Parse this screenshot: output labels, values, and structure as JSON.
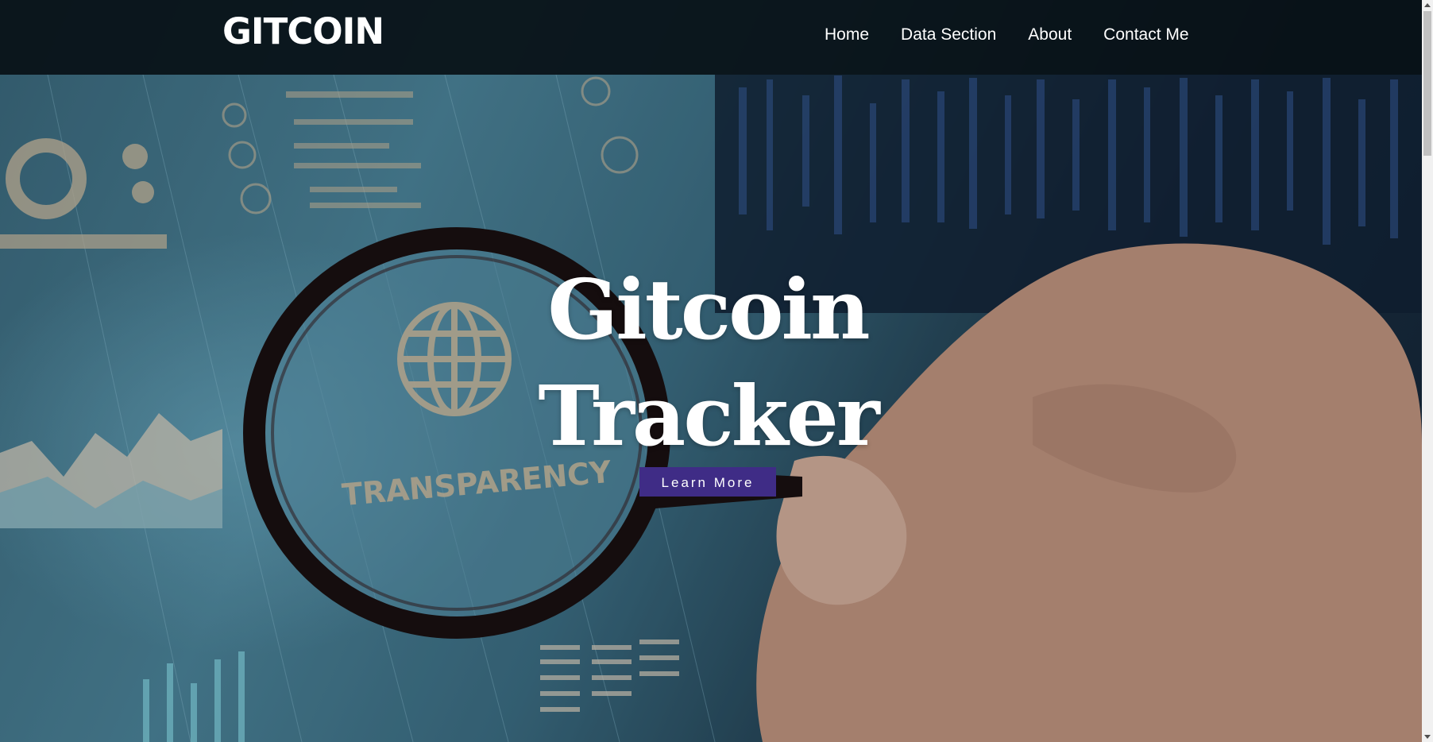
{
  "nav": {
    "logo": "GITCOIN",
    "links": [
      {
        "label": "Home"
      },
      {
        "label": "Data Section"
      },
      {
        "label": "About"
      },
      {
        "label": "Contact Me"
      }
    ]
  },
  "hero": {
    "title_line1": "Gitcoin",
    "title_line2": "Tracker",
    "button_label": "Learn More",
    "background_image_text": "TRANSPARENCY",
    "background_image_description": "hand holding magnifying glass over data dashboard"
  },
  "colors": {
    "navbar_bg": "#0b141a",
    "button_bg": "#3f2c86",
    "text": "#ffffff"
  },
  "icons": {
    "magnifier": "magnifying-glass-icon",
    "globe": "globe-icon"
  }
}
